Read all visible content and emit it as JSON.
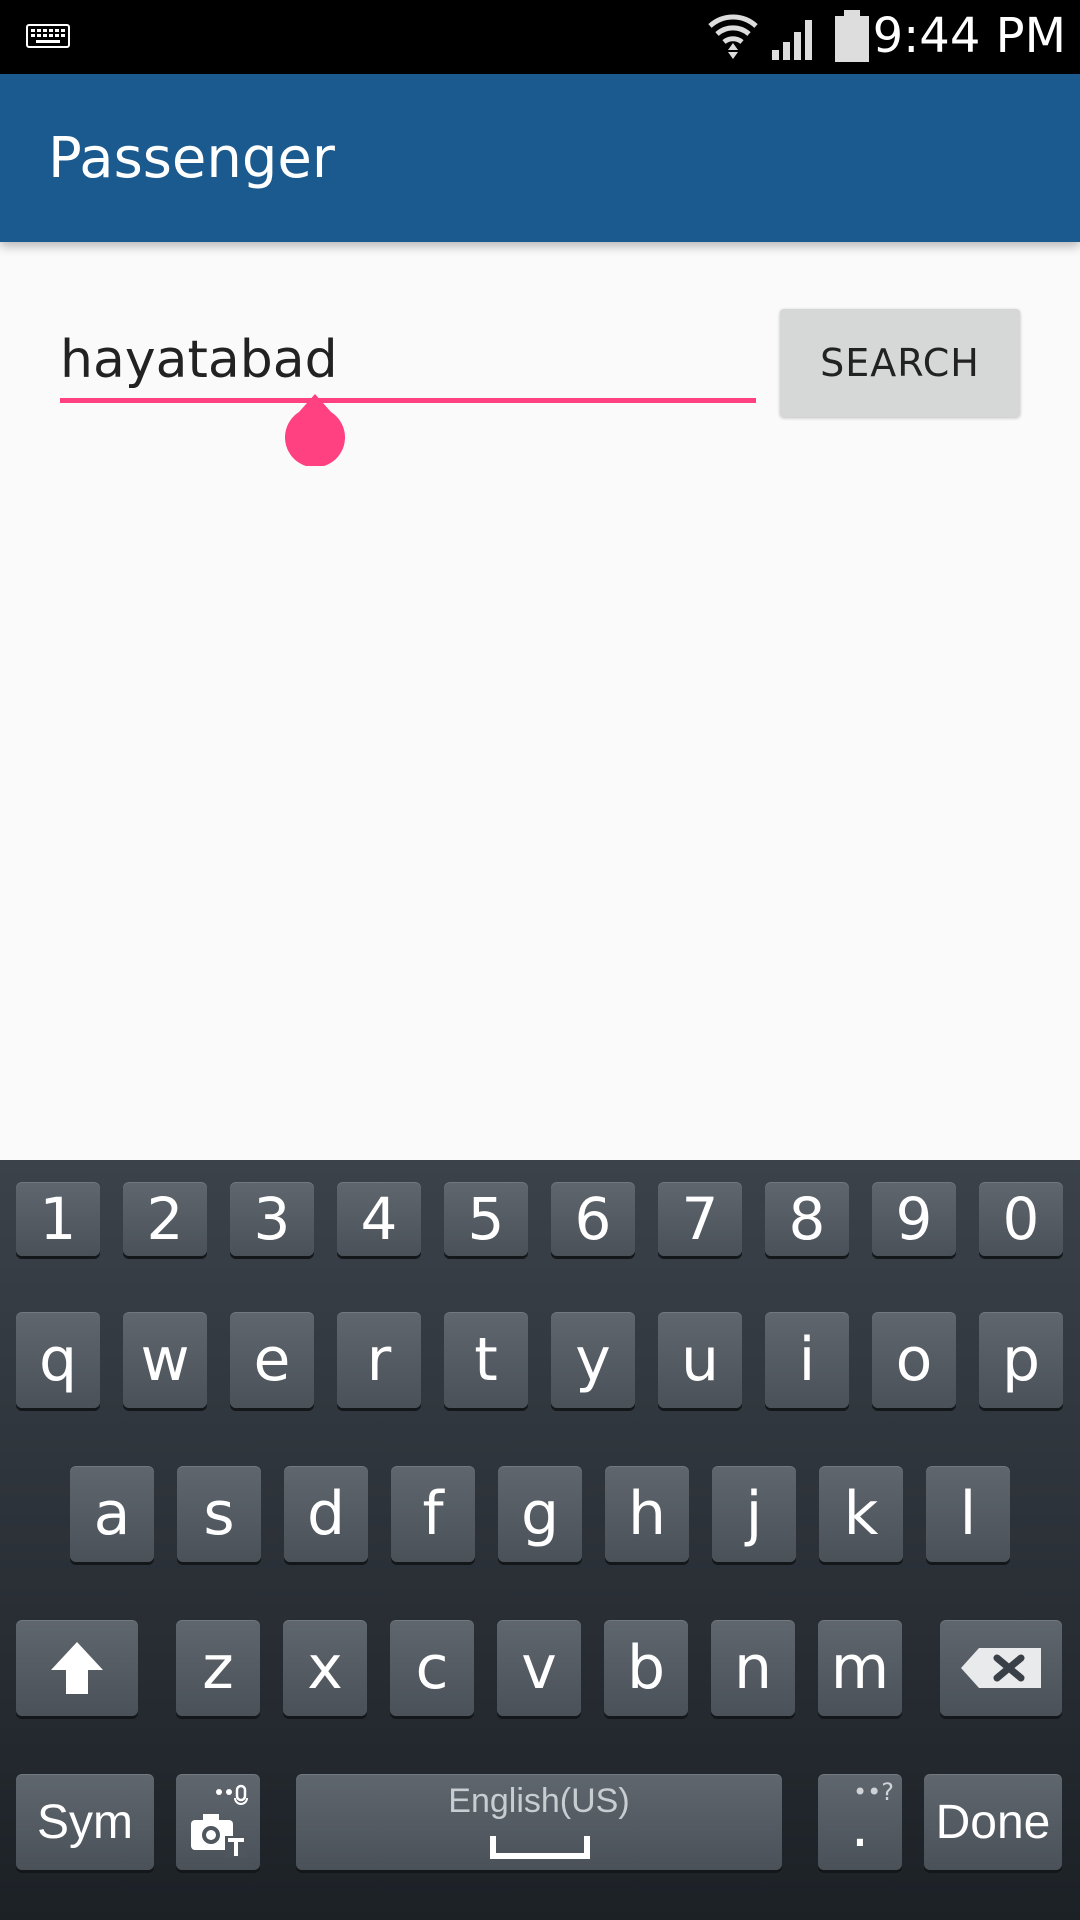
{
  "status_bar": {
    "time": "9:44 PM",
    "icons": [
      "keyboard-icon",
      "wifi-icon",
      "signal-icon",
      "battery-icon"
    ]
  },
  "app_bar": {
    "title": "Passenger",
    "background_color": "#1b5a8e"
  },
  "search": {
    "value": "hayatabad",
    "accent_color": "#ff4081",
    "button_label": "SEARCH"
  },
  "keyboard": {
    "number_row": [
      "1",
      "2",
      "3",
      "4",
      "5",
      "6",
      "7",
      "8",
      "9",
      "0"
    ],
    "row1": [
      "q",
      "w",
      "e",
      "r",
      "t",
      "y",
      "u",
      "i",
      "o",
      "p"
    ],
    "row2": [
      "a",
      "s",
      "d",
      "f",
      "g",
      "h",
      "j",
      "k",
      "l"
    ],
    "row3": [
      "z",
      "x",
      "c",
      "v",
      "b",
      "n",
      "m"
    ],
    "sym_label": "Sym",
    "language_label": "English(US)",
    "period_label": ".",
    "done_label": "Done"
  }
}
